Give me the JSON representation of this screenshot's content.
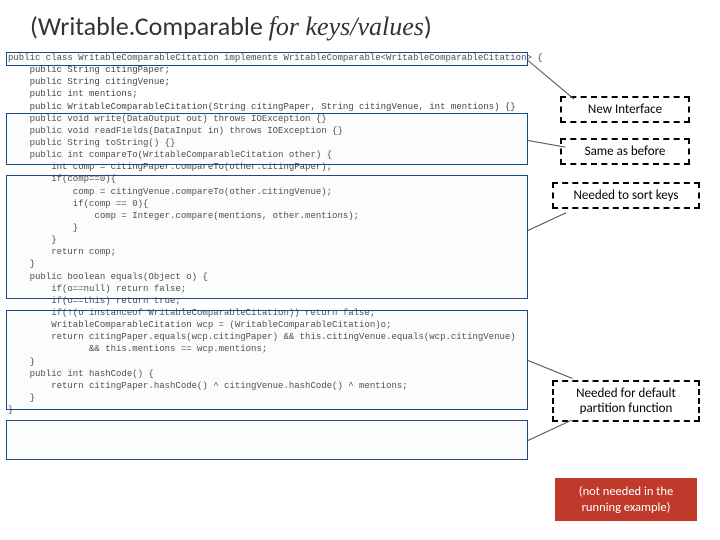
{
  "title": {
    "part1": "(Writable.Comparable ",
    "part2_italic": "for keys/values",
    "part3": ")"
  },
  "callouts": {
    "c1": "New Interface",
    "c2": "Same as before",
    "c3": "Needed to sort keys",
    "c4_l1": "Needed for default",
    "c4_l2": "partition function",
    "red_l1": "(not needed in the",
    "red_l2": "running example)"
  },
  "code": {
    "l01": "public class WritableComparableCitation implements WritableComparable<WritableComparableCitation> {",
    "l02": "    public String citingPaper;",
    "l03": "    public String citingVenue;",
    "l04": "    public int mentions;",
    "l05": "",
    "l06": "    public WritableComparableCitation(String citingPaper, String citingVenue, int mentions) {}",
    "l07": "    public void write(DataOutput out) throws IOException {}",
    "l08": "    public void readFields(DataInput in) throws IOException {}",
    "l09": "    public String toString() {}",
    "l10": "",
    "l11": "    public int compareTo(WritableComparableCitation other) {",
    "l12": "        int comp = citingPaper.compareTo(other.citingPaper);",
    "l13": "        if(comp==0){",
    "l14": "            comp = citingVenue.compareTo(other.citingVenue);",
    "l15": "            if(comp == 0){",
    "l16": "                comp = Integer.compare(mentions, other.mentions);",
    "l17": "            }",
    "l18": "        }",
    "l19": "        return comp;",
    "l20": "    }",
    "l21": "",
    "l22": "    public boolean equals(Object o) {",
    "l23": "        if(o==null) return false;",
    "l24": "        if(o==this) return true;",
    "l25": "        if(!(o instanceof WritableComparableCitation)) return false;",
    "l26": "        WritableComparableCitation wcp = (WritableComparableCitation)o;",
    "l27": "        return citingPaper.equals(wcp.citingPaper) && this.citingVenue.equals(wcp.citingVenue)",
    "l28": "               && this.mentions == wcp.mentions;",
    "l29": "    }",
    "l30": "",
    "l31": "    public int hashCode() {",
    "l32": "        return citingPaper.hashCode() ^ citingVenue.hashCode() ^ mentions;",
    "l33": "    }",
    "l34": "}"
  }
}
